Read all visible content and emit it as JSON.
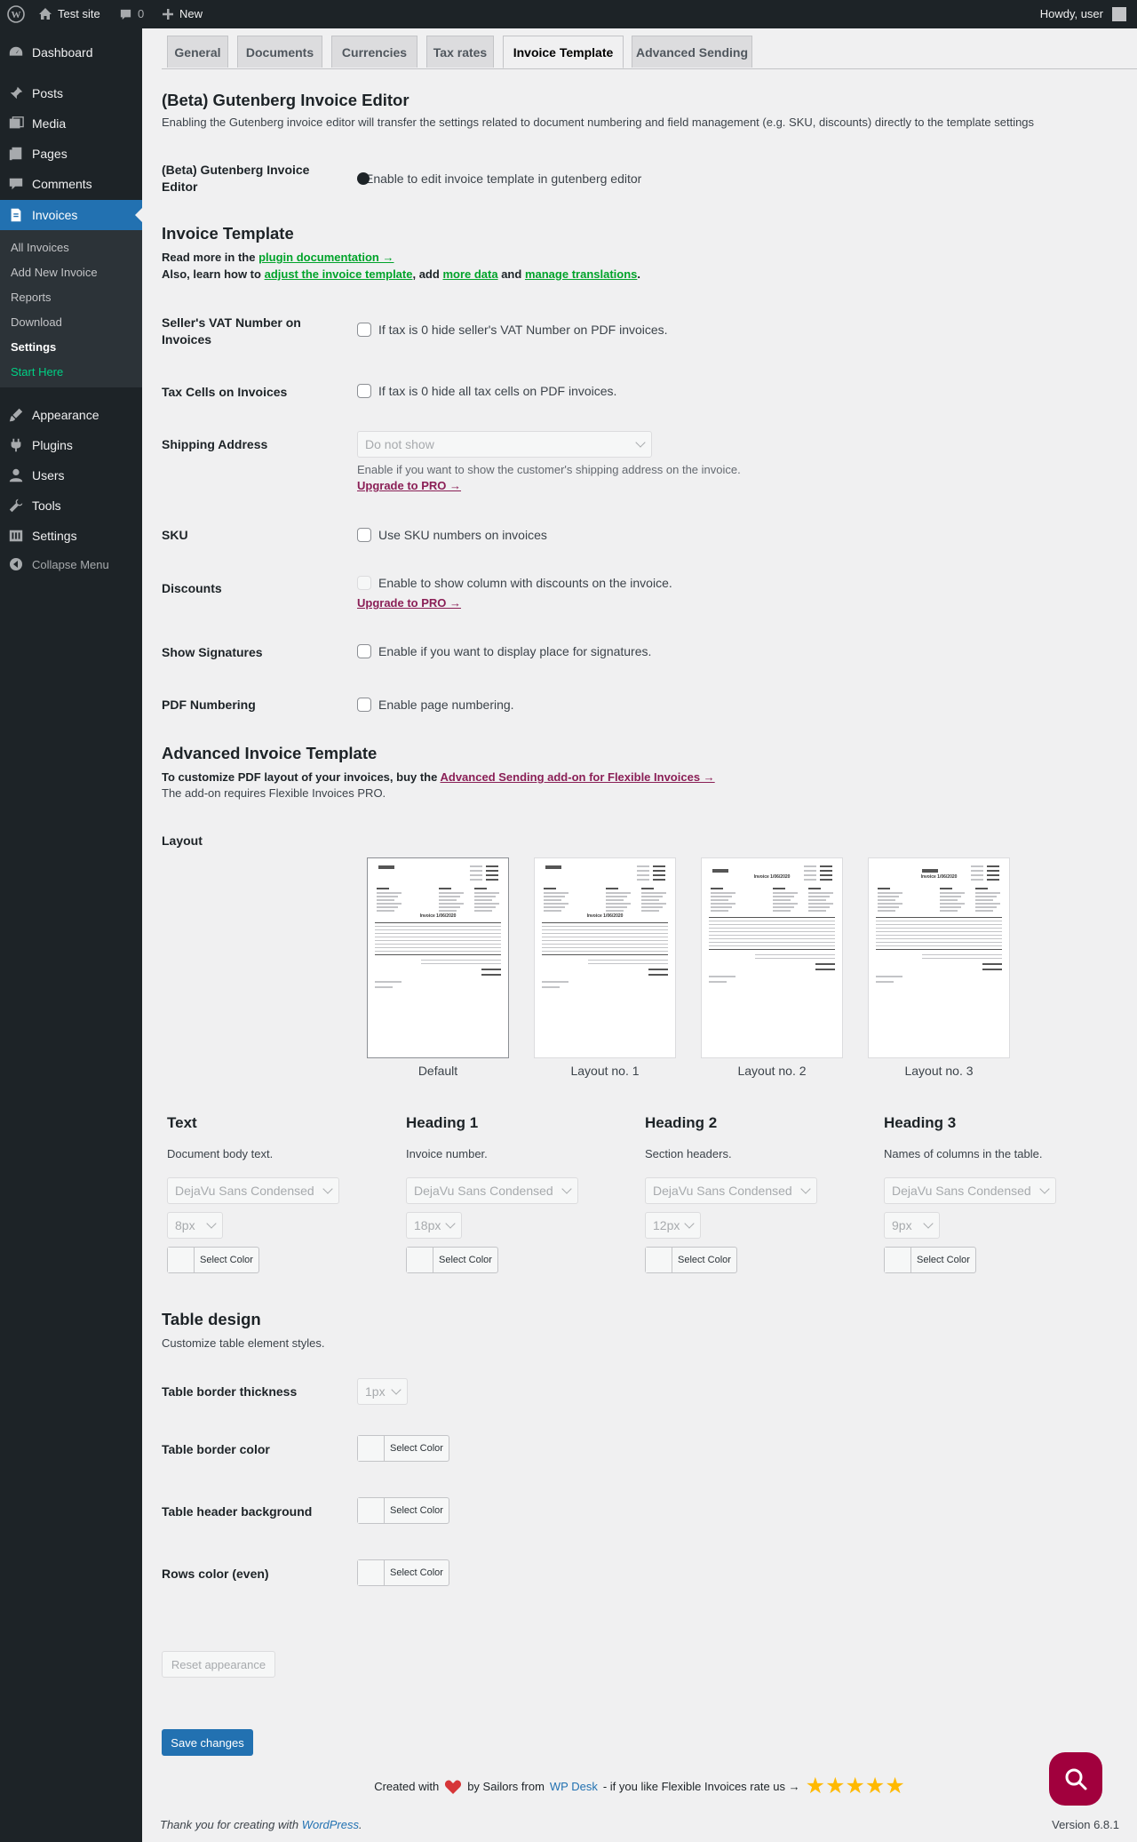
{
  "adminbar": {
    "site_name": "Test site",
    "comments_count": "0",
    "new_label": "New",
    "howdy": "Howdy, user"
  },
  "sidebar": {
    "menu": {
      "dashboard": "Dashboard",
      "posts": "Posts",
      "media": "Media",
      "pages": "Pages",
      "comments": "Comments",
      "invoices": "Invoices",
      "appearance": "Appearance",
      "plugins": "Plugins",
      "users": "Users",
      "tools": "Tools",
      "settings": "Settings",
      "collapse": "Collapse Menu"
    },
    "submenu": {
      "all": "All Invoices",
      "add": "Add New Invoice",
      "reports": "Reports",
      "download": "Download",
      "settings": "Settings",
      "start": "Start Here"
    }
  },
  "tabs": {
    "general": "General",
    "documents": "Documents",
    "currencies": "Currencies",
    "tax_rates": "Tax rates",
    "invoice_template": "Invoice Template",
    "advanced_sending": "Advanced Sending"
  },
  "gutenberg": {
    "title": "(Beta) Gutenberg Invoice Editor",
    "desc": "Enabling the Gutenberg invoice editor will transfer the settings related to document numbering and field management (e.g. SKU, discounts) directly to the template settings",
    "label": "(Beta) Gutenberg Invoice Editor",
    "toggle_text": "Enable to edit invoice template in gutenberg editor"
  },
  "invoice_template": {
    "title": "Invoice Template",
    "read_more": "Read more in the",
    "plugin_doc": "plugin documentation →",
    "also": "Also, learn how to",
    "adjust": "adjust the invoice template",
    "add": ", add",
    "more_data": "more data",
    "and": "and",
    "manage": "manage translations",
    "period": "."
  },
  "fields": {
    "vat_label": "Seller's VAT Number on Invoices",
    "vat_text": "If tax is 0 hide seller's VAT Number on PDF invoices.",
    "taxcells_label": "Tax Cells on Invoices",
    "taxcells_text": "If tax is 0 hide all tax cells on PDF invoices.",
    "shipping_label": "Shipping Address",
    "shipping_select": "Do not show",
    "shipping_desc": "Enable if you want to show the customer's shipping address on the invoice.",
    "upgrade": "Upgrade to PRO →",
    "sku_label": "SKU",
    "sku_text": "Use SKU numbers on invoices",
    "discounts_label": "Discounts",
    "discounts_text": "Enable to show column with discounts on the invoice.",
    "signatures_label": "Show Signatures",
    "signatures_text": "Enable if you want to display place for signatures.",
    "pdfnum_label": "PDF Numbering",
    "pdfnum_text": "Enable page numbering."
  },
  "advanced": {
    "title": "Advanced Invoice Template",
    "customize": "To customize PDF layout of your invoices, buy the",
    "addon_link": "Advanced Sending add-on for Flexible Invoices →",
    "requires": "The add-on requires Flexible Invoices PRO.",
    "layout_label": "Layout",
    "layouts": [
      "Default",
      "Layout no. 1",
      "Layout no. 2",
      "Layout no. 3"
    ],
    "invoice_heading": "Invoice 1/06/2020"
  },
  "fonts": [
    {
      "title": "Text",
      "desc": "Document body text.",
      "font": "DejaVu Sans Condensed",
      "size": "8px",
      "color_btn": "Select Color"
    },
    {
      "title": "Heading 1",
      "desc": "Invoice number.",
      "font": "DejaVu Sans Condensed",
      "size": "18px",
      "color_btn": "Select Color"
    },
    {
      "title": "Heading 2",
      "desc": "Section headers.",
      "font": "DejaVu Sans Condensed",
      "size": "12px",
      "color_btn": "Select Color"
    },
    {
      "title": "Heading 3",
      "desc": "Names of columns in the table.",
      "font": "DejaVu Sans Condensed",
      "size": "9px",
      "color_btn": "Select Color"
    }
  ],
  "table_design": {
    "title": "Table design",
    "desc": "Customize table element styles.",
    "border_thickness_label": "Table border thickness",
    "border_thickness_value": "1px",
    "border_color_label": "Table border color",
    "header_bg_label": "Table header background",
    "rows_color_label": "Rows color (even)",
    "select_color": "Select Color",
    "reset": "Reset appearance",
    "save": "Save changes"
  },
  "footer": {
    "created_with": "Created with",
    "by_sailors": "by Sailors from",
    "wpdesk": "WP Desk",
    "rate_us": "- if you like Flexible Invoices rate us →",
    "thank_you": "Thank you for creating with",
    "wordpress": "WordPress",
    "version": "Version 6.8.1"
  },
  "colors": {
    "accent": "#2271b1",
    "pro": "#8a1f56",
    "link_green": "#00a32a",
    "help_bubble": "#a1003d",
    "star": "#ffb900",
    "heart": "#d63638"
  }
}
